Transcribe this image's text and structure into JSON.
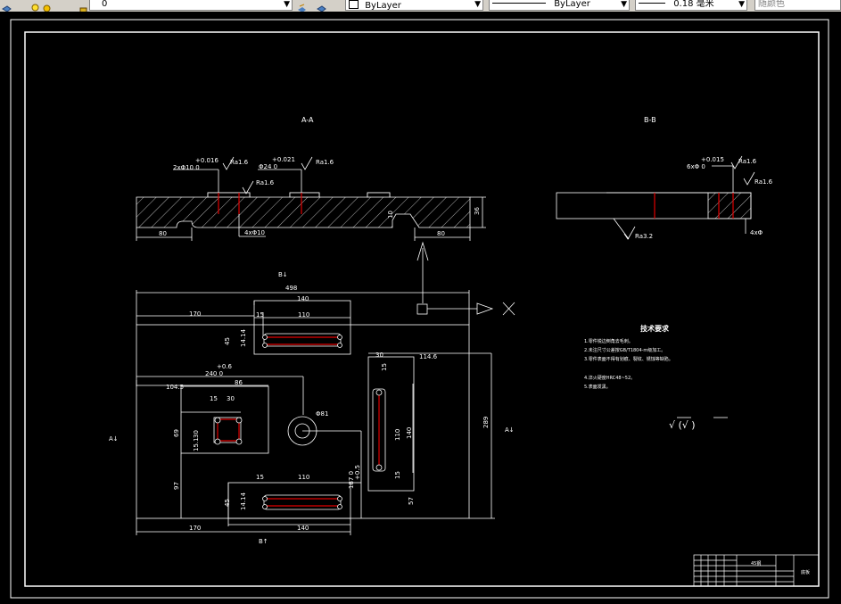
{
  "toolbar": {
    "layer_value": "0",
    "color_value": "ByLayer",
    "linetype_value": "ByLayer",
    "lineweight_value": "0.18 毫米",
    "plotstyle_value": "随颜色"
  },
  "drawing": {
    "section_aa": "A-A",
    "section_bb": "B-B",
    "view_label_top": "B↓",
    "view_label_left": "A↓",
    "view_label_right": "A↓",
    "view_label_bottom": "B↑",
    "dims": {
      "aa_tol1": "+0.016",
      "aa_dia1": "2xΦ10 0",
      "aa_tol2": "+0.021",
      "aa_dia2": "Φ24 0",
      "aa_ra1": "Ra1.6",
      "aa_ra2": "Ra1.6",
      "aa_ra3": "Ra1.6",
      "aa_80a": "80",
      "aa_80b": "80",
      "aa_4x10": "4xΦ10",
      "aa_10": "10",
      "aa_36": "36",
      "bb_tol": "+0.015",
      "bb_dia": "6xΦ 0",
      "bb_ra1": "Ra1.6",
      "bb_ra2": "Ra1.6",
      "bb_ra3": "Ra3.2",
      "bb_4x": "4xΦ",
      "d498": "498",
      "d140a": "140",
      "d170a": "170",
      "d15a": "15",
      "d110a": "110",
      "d45a": "45",
      "d144a": "14.14",
      "d06": "+0.6",
      "d2400": "240 0",
      "d86": "86",
      "d1045": "104.5",
      "d15b": "15",
      "d30a": "30",
      "d30b": "30",
      "d69": "69",
      "d151": "15.1",
      "d81": "Φ81",
      "d97": "97",
      "d15c": "15",
      "d110b": "110",
      "d05": "+0.5",
      "d1870": "187 0",
      "d45b": "45",
      "d144b": "14.14",
      "d170b": "170",
      "d140b": "140",
      "d30c": "30",
      "d1146": "114.6",
      "d15d": "15",
      "d110c": "110",
      "d140c": "140",
      "d15e": "15",
      "d57": "57",
      "d289": "289"
    },
    "tech_title": "技术要求",
    "tech_notes": [
      "1.零件锐边倒角去毛刺。",
      "2.未注尺寸公差按GB/T1804-m级加工。",
      "3.零件表面不得有划痕、裂纹、锈蚀等缺陷。",
      "4.淬火硬度HRC48~52。",
      "5.表面发黑。"
    ],
    "roughness_marks": "√  (√ )",
    "title_block": {
      "name": "底板",
      "material": "45钢"
    }
  }
}
